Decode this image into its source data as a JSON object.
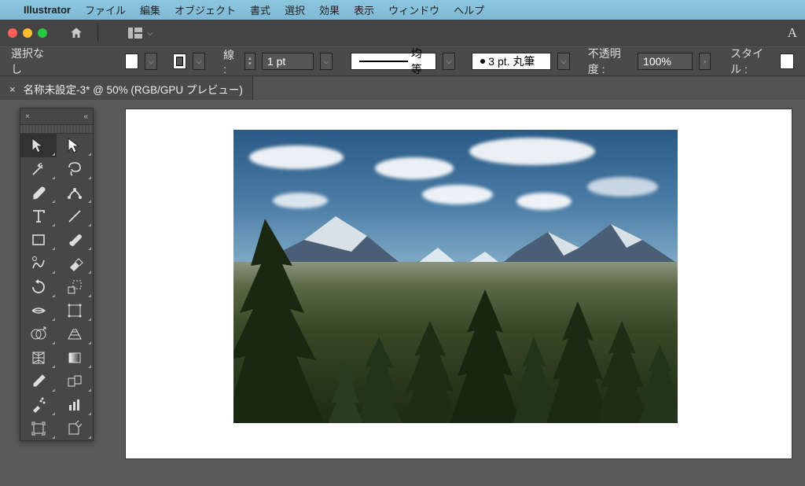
{
  "menubar": {
    "app_name": "Illustrator",
    "items": [
      "ファイル",
      "編集",
      "オブジェクト",
      "書式",
      "選択",
      "効果",
      "表示",
      "ウィンドウ",
      "ヘルプ"
    ]
  },
  "controlbar": {
    "selection_status": "選択なし",
    "stroke_label": "線 :",
    "stroke_weight": "1 pt",
    "stroke_alignment": "均等",
    "brush": "3 pt. 丸筆",
    "opacity_label": "不透明度 :",
    "opacity_value": "100%",
    "style_label": "スタイル :"
  },
  "tab": {
    "title": "名称未設定-3* @ 50% (RGB/GPU プレビュー)"
  },
  "tools": [
    [
      "selection",
      "direct-selection"
    ],
    [
      "magic-wand",
      "lasso"
    ],
    [
      "pen",
      "curvature"
    ],
    [
      "type",
      "line"
    ],
    [
      "rectangle",
      "paintbrush"
    ],
    [
      "shaper",
      "eraser"
    ],
    [
      "rotate",
      "scale"
    ],
    [
      "width",
      "free-transform"
    ],
    [
      "shape-builder",
      "perspective"
    ],
    [
      "mesh",
      "gradient"
    ],
    [
      "eyedropper",
      "blend"
    ],
    [
      "symbol-sprayer",
      "column-graph"
    ],
    [
      "artboard",
      "slice"
    ]
  ],
  "titlebar": {
    "right_glyph": "A"
  }
}
